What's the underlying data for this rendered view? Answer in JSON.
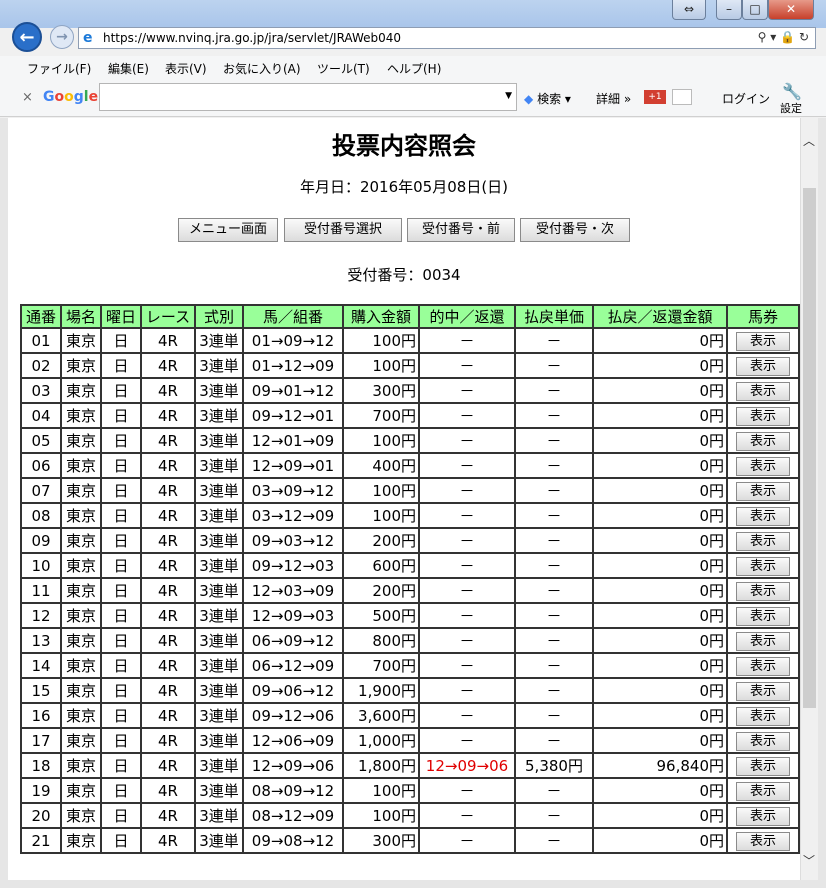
{
  "browser": {
    "url": "https://www.nvinq.jra.go.jp/jra/servlet/JRAWeb040",
    "menu": [
      "ファイル(F)",
      "編集(E)",
      "表示(V)",
      "お気に入り(A)",
      "ツール(T)",
      "ヘルプ(H)"
    ],
    "google_logo": "Google",
    "google_search_label": "検索",
    "google_detail_label": "詳細 »",
    "google_plus": "+1",
    "login_label": "ログイン",
    "settings_label": "設定",
    "close_x": "×"
  },
  "page": {
    "title": "投票内容照会",
    "date": "年月日：2016年05月08日(日)",
    "buttons": [
      "メニュー画面",
      "受付番号選択",
      "受付番号・前",
      "受付番号・次"
    ],
    "receipt": "受付番号：0034"
  },
  "table": {
    "headers": [
      "通番",
      "場名",
      "曜日",
      "レース",
      "式別",
      "馬／組番",
      "購入金額",
      "的中／返還",
      "払戻単価",
      "払戻／返還金額",
      "馬券"
    ],
    "rows": [
      [
        "01",
        "東京",
        "日",
        "4R",
        "3連単",
        "01→09→12",
        "100円",
        "－",
        "－",
        "0円",
        "表示"
      ],
      [
        "02",
        "東京",
        "日",
        "4R",
        "3連単",
        "01→12→09",
        "100円",
        "－",
        "－",
        "0円",
        "表示"
      ],
      [
        "03",
        "東京",
        "日",
        "4R",
        "3連単",
        "09→01→12",
        "300円",
        "－",
        "－",
        "0円",
        "表示"
      ],
      [
        "04",
        "東京",
        "日",
        "4R",
        "3連単",
        "09→12→01",
        "700円",
        "－",
        "－",
        "0円",
        "表示"
      ],
      [
        "05",
        "東京",
        "日",
        "4R",
        "3連単",
        "12→01→09",
        "100円",
        "－",
        "－",
        "0円",
        "表示"
      ],
      [
        "06",
        "東京",
        "日",
        "4R",
        "3連単",
        "12→09→01",
        "400円",
        "－",
        "－",
        "0円",
        "表示"
      ],
      [
        "07",
        "東京",
        "日",
        "4R",
        "3連単",
        "03→09→12",
        "100円",
        "－",
        "－",
        "0円",
        "表示"
      ],
      [
        "08",
        "東京",
        "日",
        "4R",
        "3連単",
        "03→12→09",
        "100円",
        "－",
        "－",
        "0円",
        "表示"
      ],
      [
        "09",
        "東京",
        "日",
        "4R",
        "3連単",
        "09→03→12",
        "200円",
        "－",
        "－",
        "0円",
        "表示"
      ],
      [
        "10",
        "東京",
        "日",
        "4R",
        "3連単",
        "09→12→03",
        "600円",
        "－",
        "－",
        "0円",
        "表示"
      ],
      [
        "11",
        "東京",
        "日",
        "4R",
        "3連単",
        "12→03→09",
        "200円",
        "－",
        "－",
        "0円",
        "表示"
      ],
      [
        "12",
        "東京",
        "日",
        "4R",
        "3連単",
        "12→09→03",
        "500円",
        "－",
        "－",
        "0円",
        "表示"
      ],
      [
        "13",
        "東京",
        "日",
        "4R",
        "3連単",
        "06→09→12",
        "800円",
        "－",
        "－",
        "0円",
        "表示"
      ],
      [
        "14",
        "東京",
        "日",
        "4R",
        "3連単",
        "06→12→09",
        "700円",
        "－",
        "－",
        "0円",
        "表示"
      ],
      [
        "15",
        "東京",
        "日",
        "4R",
        "3連単",
        "09→06→12",
        "1,900円",
        "－",
        "－",
        "0円",
        "表示"
      ],
      [
        "16",
        "東京",
        "日",
        "4R",
        "3連単",
        "09→12→06",
        "3,600円",
        "－",
        "－",
        "0円",
        "表示"
      ],
      [
        "17",
        "東京",
        "日",
        "4R",
        "3連単",
        "12→06→09",
        "1,000円",
        "－",
        "－",
        "0円",
        "表示"
      ],
      [
        "18",
        "東京",
        "日",
        "4R",
        "3連単",
        "12→09→06",
        "1,800円",
        "12→09→06",
        "5,380円",
        "96,840円",
        "表示"
      ],
      [
        "19",
        "東京",
        "日",
        "4R",
        "3連単",
        "08→09→12",
        "100円",
        "－",
        "－",
        "0円",
        "表示"
      ],
      [
        "20",
        "東京",
        "日",
        "4R",
        "3連単",
        "08→12→09",
        "100円",
        "－",
        "－",
        "0円",
        "表示"
      ],
      [
        "21",
        "東京",
        "日",
        "4R",
        "3連単",
        "09→08→12",
        "300円",
        "－",
        "－",
        "0円",
        "表示"
      ]
    ],
    "hit_color": "#e00000",
    "header_color": "#99ff99"
  }
}
